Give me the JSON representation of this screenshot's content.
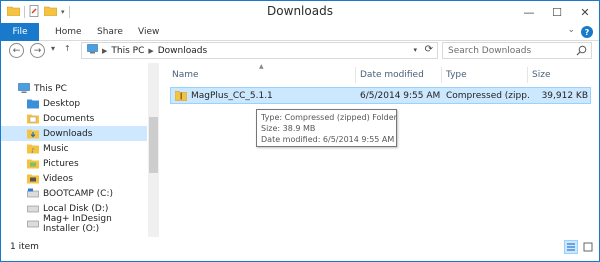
{
  "window": {
    "title": "Downloads"
  },
  "ribbon": {
    "file": "File",
    "home": "Home",
    "share": "Share",
    "view": "View"
  },
  "nav": {
    "address": [
      "This PC",
      "Downloads"
    ],
    "search_placeholder": "Search Downloads"
  },
  "navpane": {
    "items": [
      {
        "label": "This PC",
        "icon": "computer-icon"
      },
      {
        "label": "Desktop",
        "icon": "desktop-folder-icon"
      },
      {
        "label": "Documents",
        "icon": "documents-folder-icon"
      },
      {
        "label": "Downloads",
        "icon": "downloads-folder-icon",
        "selected": true
      },
      {
        "label": "Music",
        "icon": "music-folder-icon"
      },
      {
        "label": "Pictures",
        "icon": "pictures-folder-icon"
      },
      {
        "label": "Videos",
        "icon": "videos-folder-icon"
      },
      {
        "label": "BOOTCAMP (C:)",
        "icon": "drive-icon"
      },
      {
        "label": "Local Disk (D:)",
        "icon": "drive-icon"
      },
      {
        "label": "Mag+ InDesign Installer (O:)",
        "icon": "drive-icon"
      }
    ]
  },
  "columns": {
    "name": "Name",
    "date": "Date modified",
    "type": "Type",
    "size": "Size"
  },
  "files": [
    {
      "name": "MagPlus_CC_5.1.1",
      "date": "6/5/2014 9:55 AM",
      "type": "Compressed (zipp...",
      "size": "39,912 KB"
    }
  ],
  "tooltip": {
    "type": "Type: Compressed (zipped) Folder",
    "size": "Size: 38.9 MB",
    "date": "Date modified: 6/5/2014 9:55 AM"
  },
  "status": {
    "count": "1 item"
  },
  "colors": {
    "accent": "#1979ca",
    "selection": "#cce8ff",
    "folder": "#f5c342"
  }
}
